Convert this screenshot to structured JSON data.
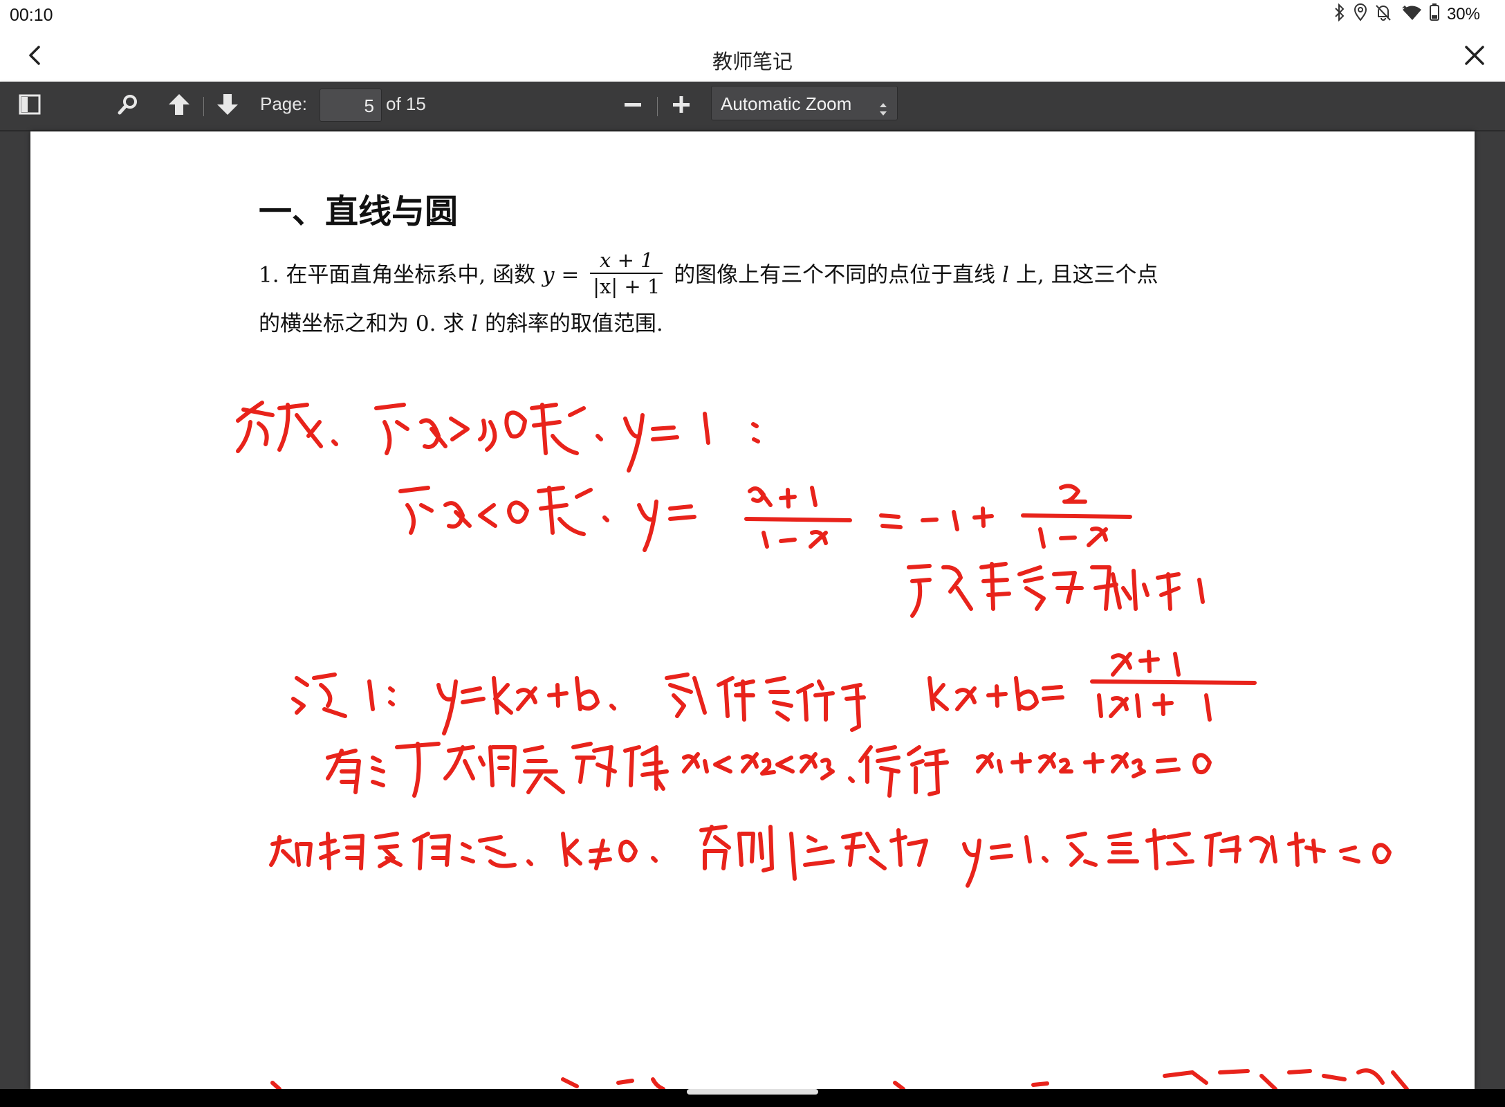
{
  "status_bar": {
    "time": "00:10",
    "battery": "30%",
    "icons": [
      "bluetooth-icon",
      "location-icon",
      "notifications-off-icon",
      "wifi-icon",
      "battery-icon"
    ]
  },
  "title_bar": {
    "title": "教师笔记",
    "back_icon": "back-arrow-icon",
    "close_icon": "close-icon"
  },
  "pdf_toolbar": {
    "sidebar_toggle_icon": "sidebar-toggle-icon",
    "search_icon": "search-icon",
    "previous_icon": "previous-page-icon",
    "next_icon": "next-page-icon",
    "page_label": "Page:",
    "page_number": "5",
    "page_count": "of 15",
    "zoom_out_icon": "zoom-out-icon",
    "zoom_in_icon": "zoom-in-icon",
    "zoom_value": "Automatic Zoom"
  },
  "document": {
    "heading": "一、直线与圆",
    "problem": {
      "number": "1.",
      "text_before": "在平面直角坐标系中, 函数",
      "var_y": "y",
      "equals": "=",
      "frac_numerator": "x + 1",
      "frac_denominator": "|x| + 1",
      "text_middle": "的图像上有三个不同的点位于直线",
      "var_l": "l",
      "text_after": "上, 且这三个点",
      "line2_before": "的横坐标之和为 0. 求",
      "line2_var": "l",
      "line2_after": "的斜率的取值范围."
    }
  },
  "colors": {
    "ink": "#e8231b",
    "toolbar": "#3a3a3b",
    "viewer_bg": "#3c3c3d"
  }
}
